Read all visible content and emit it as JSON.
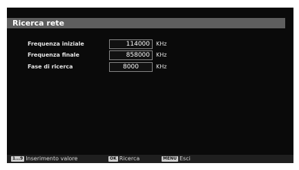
{
  "window": {
    "title": "Ricerca rete"
  },
  "fields": [
    {
      "label": "Frequenza iniziale",
      "value": "114000",
      "unit": "KHz"
    },
    {
      "label": "Frequenza finale",
      "value": "858000",
      "unit": "KHz"
    },
    {
      "label": "Fase di ricerca",
      "value": "8000",
      "unit": "KHz"
    }
  ],
  "footer": {
    "digits_key": "1...9",
    "digits_label": "Inserimento valore",
    "ok_key": "OK",
    "ok_label": "Ricerca",
    "menu_key": "MENU",
    "menu_label": "Esci"
  },
  "colors": {
    "background": "#0a0a0a",
    "title_bar": "#5e5e5e",
    "text": "#e6e6e6",
    "key_badge": "#cfcfcf"
  }
}
